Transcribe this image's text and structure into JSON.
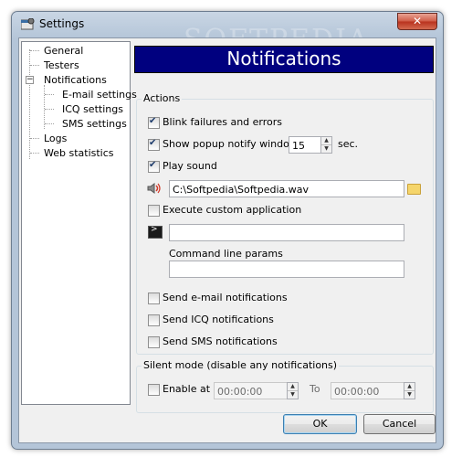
{
  "window": {
    "title": "Settings",
    "close_label": "✕",
    "watermark": "SOFTPEDIA"
  },
  "tree": {
    "items": [
      {
        "label": "General"
      },
      {
        "label": "Testers"
      },
      {
        "label": "Notifications"
      },
      {
        "label": "E-mail settings"
      },
      {
        "label": "ICQ settings"
      },
      {
        "label": "SMS settings"
      },
      {
        "label": "Logs"
      },
      {
        "label": "Web statistics"
      }
    ],
    "expander_symbol": "−"
  },
  "header": {
    "title": "Notifications"
  },
  "actions": {
    "group_label": "Actions",
    "blink": {
      "label": "Blink failures and errors",
      "checked": true
    },
    "popup": {
      "label": "Show popup notify window",
      "checked": true,
      "value": "15",
      "unit": "sec."
    },
    "sound": {
      "label": "Play sound",
      "checked": true,
      "path": "C:\\Softpedia\\Softpedia.wav"
    },
    "custom_app": {
      "label": "Execute custom application",
      "checked": false,
      "path": "",
      "params_label": "Command line params",
      "params": ""
    },
    "email": {
      "label": "Send e-mail notifications",
      "checked": false
    },
    "icq": {
      "label": "Send ICQ notifications",
      "checked": false
    },
    "sms": {
      "label": "Send SMS notifications",
      "checked": false
    }
  },
  "silent": {
    "group_label": "Silent mode (disable any notifications)",
    "enable_label": "Enable at",
    "from": "00:00:00",
    "to_label": "To",
    "to": "00:00:00"
  },
  "buttons": {
    "ok": "OK",
    "cancel": "Cancel"
  },
  "colors": {
    "banner": "#00007f",
    "close": "#c9462f"
  }
}
